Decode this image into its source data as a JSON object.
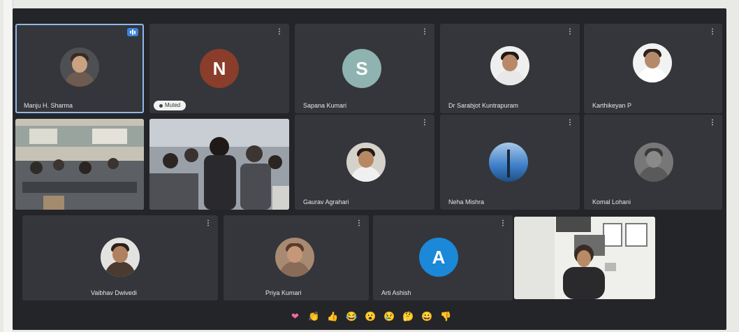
{
  "participants": [
    {
      "id": "p1",
      "name": "Manju H. Sharma",
      "type": "photo",
      "skin": "#c9a27f",
      "hair": "#3a2a22",
      "body": "#6e5a4e",
      "bg": "#4e4f53",
      "speaking": true
    },
    {
      "id": "p2",
      "name": "",
      "type": "initial",
      "initial": "N",
      "color": "#8a3d2a",
      "muted_label": "Muted"
    },
    {
      "id": "p3",
      "name": "Sapana Kumari",
      "type": "initial",
      "initial": "S",
      "color": "#8fb3b0"
    },
    {
      "id": "p4",
      "name": "Dr Sarabjot Kuntrapuram",
      "type": "photo",
      "skin": "#b98866",
      "hair": "#1f1a18",
      "body": "#e8e8e8",
      "bg": "#efefef"
    },
    {
      "id": "p5",
      "name": "Karthikeyan P",
      "type": "photo",
      "skin": "#b58a6b",
      "hair": "#2b211c",
      "body": "#ffffff",
      "bg": "#f2f2f2"
    },
    {
      "id": "p6",
      "name": "",
      "type": "video"
    },
    {
      "id": "p7",
      "name": "",
      "type": "video"
    },
    {
      "id": "p8",
      "name": "Gaurav Agrahari",
      "type": "photo",
      "skin": "#b88862",
      "hair": "#221a15",
      "body": "#f0f0f0",
      "bg": "#d5d2cb"
    },
    {
      "id": "p9",
      "name": "Neha Mishra",
      "type": "sky",
      "color": "#3c7ec8"
    },
    {
      "id": "p10",
      "name": "Komal Lohani",
      "type": "photo",
      "skin": "#8a8a8a",
      "hair": "#3a3a3a",
      "body": "#5a5a5a",
      "bg": "#777777"
    },
    {
      "id": "p11",
      "name": "Vaibhav Dwivedi",
      "type": "photo",
      "skin": "#b08060",
      "hair": "#2a201a",
      "body": "#4a3a30",
      "bg": "#e2e2e0"
    },
    {
      "id": "p12",
      "name": "Priya Kumari",
      "type": "photo",
      "skin": "#c49878",
      "hair": "#5a3a28",
      "body": "#8a6a58",
      "bg": "#a88a72"
    },
    {
      "id": "p13",
      "name": "Arti Ashish",
      "type": "initial",
      "initial": "A",
      "color": "#1b88d8"
    },
    {
      "id": "p14",
      "name": "",
      "type": "video"
    }
  ],
  "reactions": [
    {
      "emoji": "❤",
      "name": "heart-reaction",
      "color": "#f06aa0"
    },
    {
      "emoji": "👏",
      "name": "clap-reaction",
      "color": "#f5c542"
    },
    {
      "emoji": "👍",
      "name": "thumbs-up-reaction",
      "color": "#d8b067"
    },
    {
      "emoji": "😂",
      "name": "laugh-reaction",
      "color": "#f7d23e"
    },
    {
      "emoji": "😮",
      "name": "surprised-reaction",
      "color": "#f7d23e"
    },
    {
      "emoji": "😢",
      "name": "sad-reaction",
      "color": "#f7d23e"
    },
    {
      "emoji": "🤔",
      "name": "thinking-reaction",
      "color": "#f7d23e"
    },
    {
      "emoji": "😀",
      "name": "smile-reaction",
      "color": "#f7d23e"
    },
    {
      "emoji": "👎",
      "name": "thumbs-down-reaction",
      "color": "#e8b84a"
    }
  ],
  "tile_menu_glyph": "⋮"
}
